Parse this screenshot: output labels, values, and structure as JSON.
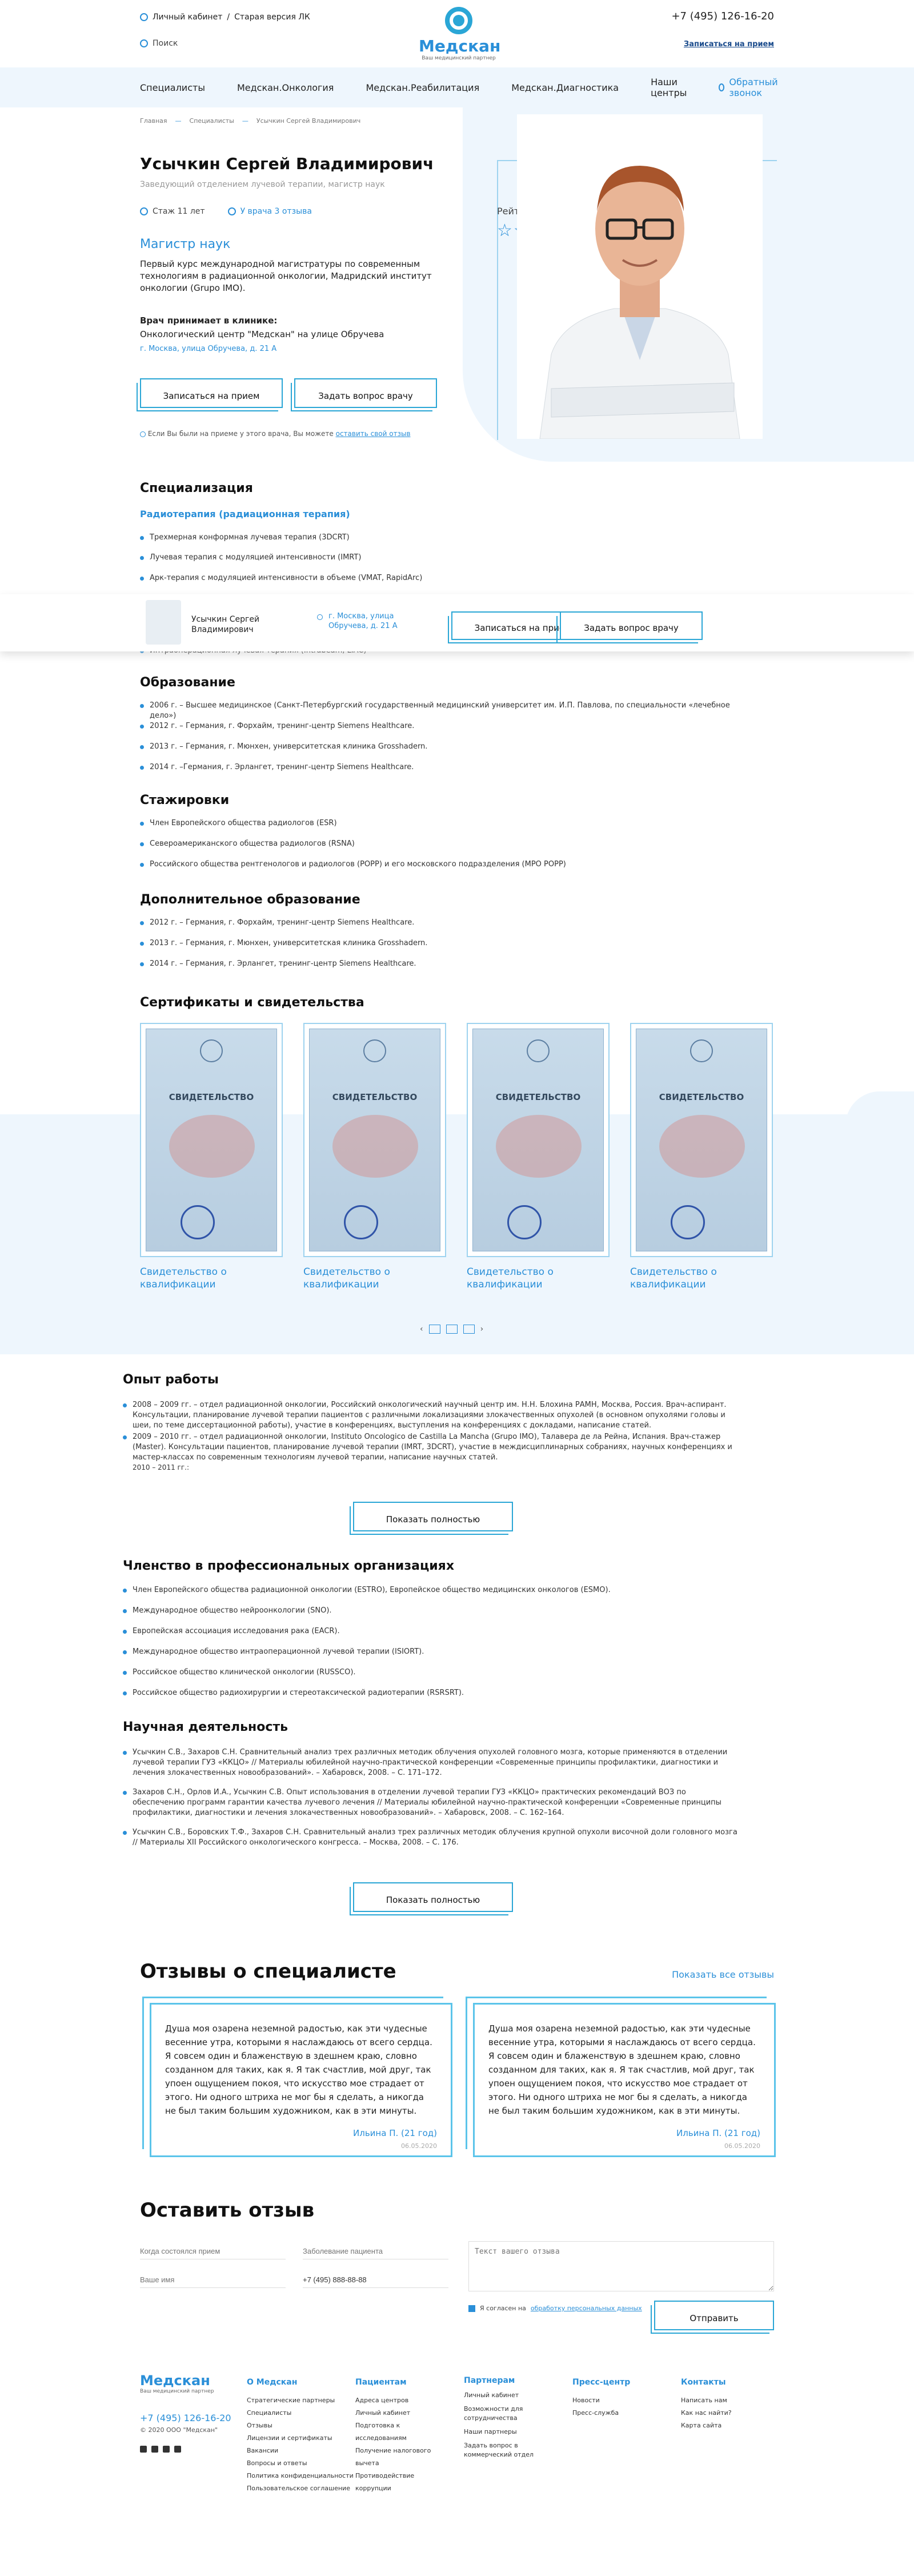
{
  "header": {
    "lk": "Личный кабинет",
    "old_lk": "Старая версия ЛК",
    "search": "Поиск",
    "logo_name": "Медскан",
    "logo_tag": "Ваш медицинский партнер",
    "phone": "+7 (495) 126-16-20",
    "appt": "Записаться на прием"
  },
  "nav": {
    "items": [
      "Специалисты",
      "Медскан.Онкология",
      "Медскан.Реабилитация",
      "Медскан.Диагностика",
      "Наши центры"
    ],
    "callback": "Обратный звонок"
  },
  "crumbs": [
    "Главная",
    "Специалисты",
    "Усычкин Сергей Владимирович"
  ],
  "doctor": {
    "name": "Усычкин Сергей Владимирович",
    "position": "Заведующий отделением лучевой терапии, магистр наук",
    "exp": "Стаж 11 лет",
    "rating_count": "У врача 3 отзыва",
    "degree": "Магистр наук",
    "desc": "Первый курс международной магистратуры по современным технологиям в радиационной онкологии, Мадридский институт онкологии (Grupo IMO).",
    "clinic_h": "Врач принимает в клинике:",
    "clinic": "Онкологический центр \"Медскан\" на улице Обручева",
    "addr": "г. Москва, улица Обручева, д. 21 А",
    "btn_appt": "Записаться на прием",
    "btn_ask": "Задать вопрос врачу",
    "note": "Если Вы были на приеме у этого врача, Вы можете",
    "note_link": "оставить свой отзыв",
    "rating_label": "Рейтинг врача",
    "stars": "☆☆☆☆☆"
  },
  "sticky": {
    "name": "Усычкин Сергей Владимирович",
    "addr": "г. Москва, улица Обручева, д. 21 А",
    "btn_appt": "Записаться на прием",
    "btn_ask": "Задать вопрос врачу"
  },
  "spec": {
    "title": "Специализация",
    "sub": "Радиотерапия (радиационная терапия)",
    "items": [
      "Трехмерная конформная лучевая терапия (3DCRT)",
      "Лучевая терапия с модуляцией интенсивности (IMRT)",
      "Арк-терапия с модуляцией интенсивности в объеме (VMAT, RapidArc)",
      "Интраоперационная лучевая терапия (Intrabeam, LIAC)"
    ]
  },
  "edu": {
    "title": "Образование",
    "items": [
      "2006 г. – Высшее медицинское (Санкт-Петербургский государственный медицинский университет им. И.П. Павлова, по специальности «лечебное дело»)",
      "2012 г. – Германия, г. Форхайм, тренинг-центр Siemens Healthcare.",
      "2013 г. – Германия, г. Мюнхен, университетская клиника Grosshadern.",
      "2014 г. –Германия, г. Эрлангет, тренинг-центр Siemens Healthcare."
    ]
  },
  "intern": {
    "title": "Стажировки",
    "items": [
      "Член Европейского общества радиологов (ESR)",
      "Североамериканского общества радиологов (RSNA)",
      "Российского общества рентгенологов и радиологов (РОРР) и его московского подразделения (МРО РОРР)"
    ]
  },
  "addedu": {
    "title": "Дополнительное образование",
    "items": [
      "2012 г. – Германия, г. Форхайм, тренинг-центр Siemens Healthcare.",
      "2013 г. – Германия, г. Мюнхен, университетская клиника Grosshadern.",
      "2014 г. – Германия, г. Эрлангет, тренинг-центр Siemens Healthcare."
    ]
  },
  "certs": {
    "title": "Сертификаты и свидетельства",
    "paper_title": "СВИДЕТЕЛЬСТВО",
    "items": [
      "Свидетельство о квалификации",
      "Свидетельство о квалификации",
      "Свидетельство о квалификации",
      "Свидетельство о квалификации"
    ],
    "pages": [
      "1",
      "2",
      "3"
    ]
  },
  "work": {
    "title": "Опыт работы",
    "p1": "2008 – 2009 гг. – отдел радиационной онкологии, Российский онкологический научный центр им. Н.Н. Блохина РАМН, Москва, Россия. Врач-аспирант. Консультации, планирование лучевой терапии пациентов с различными локализациями злокачественных опухолей (в основном опухолями головы и шеи, по теме диссертационной работы), участие в конференциях, выступления на конференциях с докладами, написание статей.",
    "p2": "2009 – 2010 гг. – отдел радиационной онкологии, Instituto Oncologico de Castilla La Mancha (Grupo IMO), Талавера де ла Рейна, Испания. Врач-стажер (Master). Консультации пациентов, планирование лучевой терапии (IMRT, 3DCRT), участие в междисциплинарных собраниях, научных конференциях и мастер-классах по современным технологиям лучевой терапии, написание научных статей.",
    "p3": "2010 – 2011 гг.:",
    "show_all": "Показать полностью"
  },
  "member": {
    "title": "Членство в профессиональных организациях",
    "items": [
      "Член Европейского общества радиационной онкологии (ESTRO), Европейское общество медицинских онкологов (ESMO).",
      "Международное общество нейроонкологии (SNO).",
      "Европейская ассоциация исследования рака (EACR).",
      "Международное общество интраоперационной лучевой терапии (ISIORT).",
      "Российское общество клинической онкологии (RUSSCO).",
      "Российское общество радиохирургии и стереотаксической радиотерапии (RSRSRT)."
    ]
  },
  "science": {
    "title": "Научная деятельность",
    "items": [
      "Усычкин С.В., Захаров С.Н. Сравнительный анализ трех различных методик облучения опухолей головного мозга, которые применяются в отделении лучевой терапии ГУЗ «ККЦО» // Материалы юбилейной научно-практической конференции «Современные принципы профилактики, диагностики и лечения злокачественных новообразований». – Хабаровск, 2008. – С. 171–172.",
      "Захаров С.Н., Орлов И.А., Усычкин С.В. Опыт использования в отделении лучевой терапии ГУЗ «ККЦО» практических рекомендаций ВОЗ по обеспечению программ гарантии качества лучевого лечения // Материалы юбилейной научно-практической конференции «Современные принципы профилактики, диагностики и лечения злокачественных новообразований». – Хабаровск, 2008. – С. 162–164.",
      "Усычкин С.В., Боровских Т.Ф., Захаров С.Н. Сравнительный анализ трех различных методик облучения крупной опухоли височной доли головного мозга // Материалы XII Российского онкологического конгресса. – Москва, 2008. – С. 176."
    ],
    "show_all": "Показать полностью"
  },
  "reviews": {
    "title": "Отзывы о специалисте",
    "all": "Показать все отзывы",
    "items": [
      {
        "text": "Душа моя озарена неземной радостью, как эти чудесные весенние утра, которыми я наслаждаюсь от всего сердца. Я совсем один и блаженствую в здешнем краю, словно созданном для таких, как я. Я так счастлив, мой друг, так упоен ощущением покоя, что искусство мое страдает от этого. Ни одного штриха не мог бы я сделать, а никогда не был таким большим художником, как в эти минуты.",
        "author": "Ильина П. (21 год)",
        "date": "06.05.2020"
      },
      {
        "text": "Душа моя озарена неземной радостью, как эти чудесные весенние утра, которыми я наслаждаюсь от всего сердца. Я совсем один и блаженствую в здешнем краю, словно созданном для таких, как я. Я так счастлив, мой друг, так упоен ощущением покоя, что искусство мое страдает от этого. Ни одного штриха не мог бы я сделать, а никогда не был таким большим художником, как в эти минуты.",
        "author": "Ильина П. (21 год)",
        "date": "06.05.2020"
      }
    ]
  },
  "form": {
    "title": "Оставить отзыв",
    "ph_date": "Когда состоялся прием",
    "ph_treat": "Заболевание пациента",
    "ph_name": "Ваше имя",
    "phone": "+7 (495) 888-88-88",
    "ph_text": "Текст вашего отзыва",
    "consent": "Я согласен на",
    "consent_link": "обработку персональных данных",
    "send": "Отправить"
  },
  "footer": {
    "logo_name": "Медскан",
    "logo_tag": "Ваш медицинский партнер",
    "phone": "+7 (495) 126-16-20",
    "mail": "© 2020 ООО \"Медскан\"",
    "cols": [
      {
        "title": "О Медскан",
        "items": [
          "Стратегические партнеры",
          "Специалисты",
          "Отзывы",
          "Лицензии и сертификаты",
          "Вакансии",
          "Вопросы и ответы",
          "Политика конфиденциальности",
          "Пользовательское соглашение"
        ]
      },
      {
        "title": "Пациентам",
        "items": [
          "Адреса центров",
          "Личный кабинет",
          "Подготовка к исследованиям",
          "Получение налогового вычета",
          "Противодействие коррупции"
        ]
      },
      {
        "title": "Партнерам",
        "items": [
          "Личный кабинет",
          "Возможности для сотрудничества",
          "Наши партнеры",
          "Задать вопрос в коммерческий отдел"
        ]
      },
      {
        "title": "Пресс-центр",
        "items": [
          "Новости",
          "Пресс-служба"
        ]
      },
      {
        "title": "Контакты",
        "items": [
          "Написать нам",
          "Как нас найти?",
          "Карта сайта"
        ]
      }
    ]
  }
}
